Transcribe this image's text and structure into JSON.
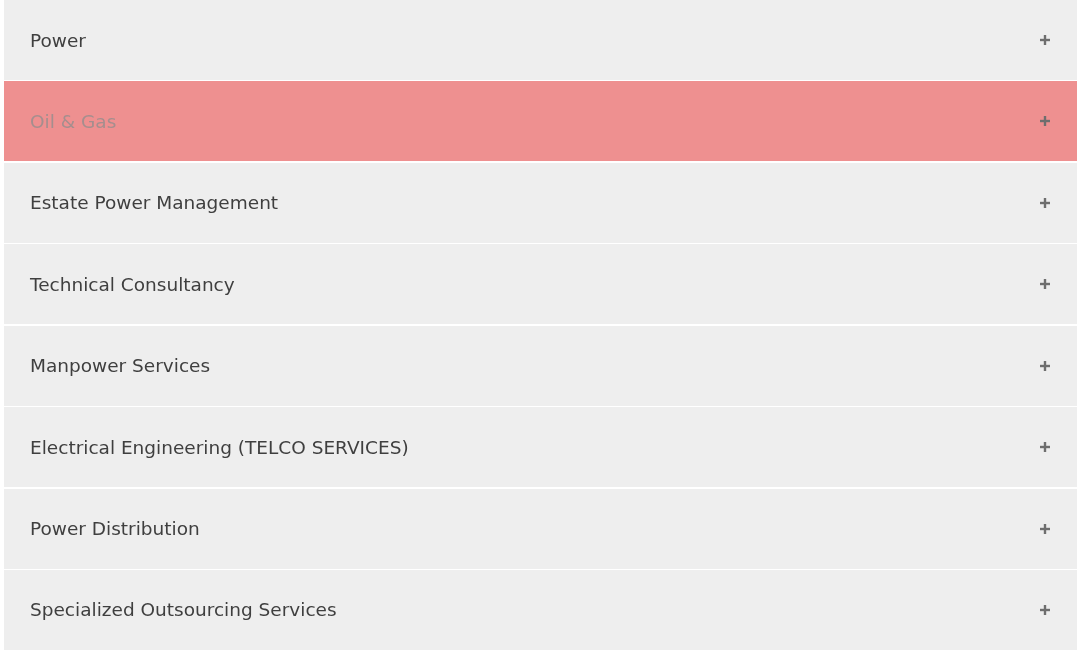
{
  "items": [
    {
      "label": "Power",
      "selected": false,
      "expanded": false
    },
    {
      "label": "Oil & Gas",
      "selected": true,
      "expanded": false
    },
    {
      "label": "Estate Power Management",
      "selected": false,
      "expanded": false
    },
    {
      "label": "Technical Consultancy",
      "selected": false,
      "expanded": false
    },
    {
      "label": "Manpower Services",
      "selected": false,
      "expanded": false
    },
    {
      "label": "Electrical Engineering (TELCO SERVICES)",
      "selected": false,
      "expanded": false
    },
    {
      "label": "Power Distribution",
      "selected": false,
      "expanded": false
    },
    {
      "label": "Specialized Outsourcing Services",
      "selected": false,
      "expanded": false
    }
  ]
}
